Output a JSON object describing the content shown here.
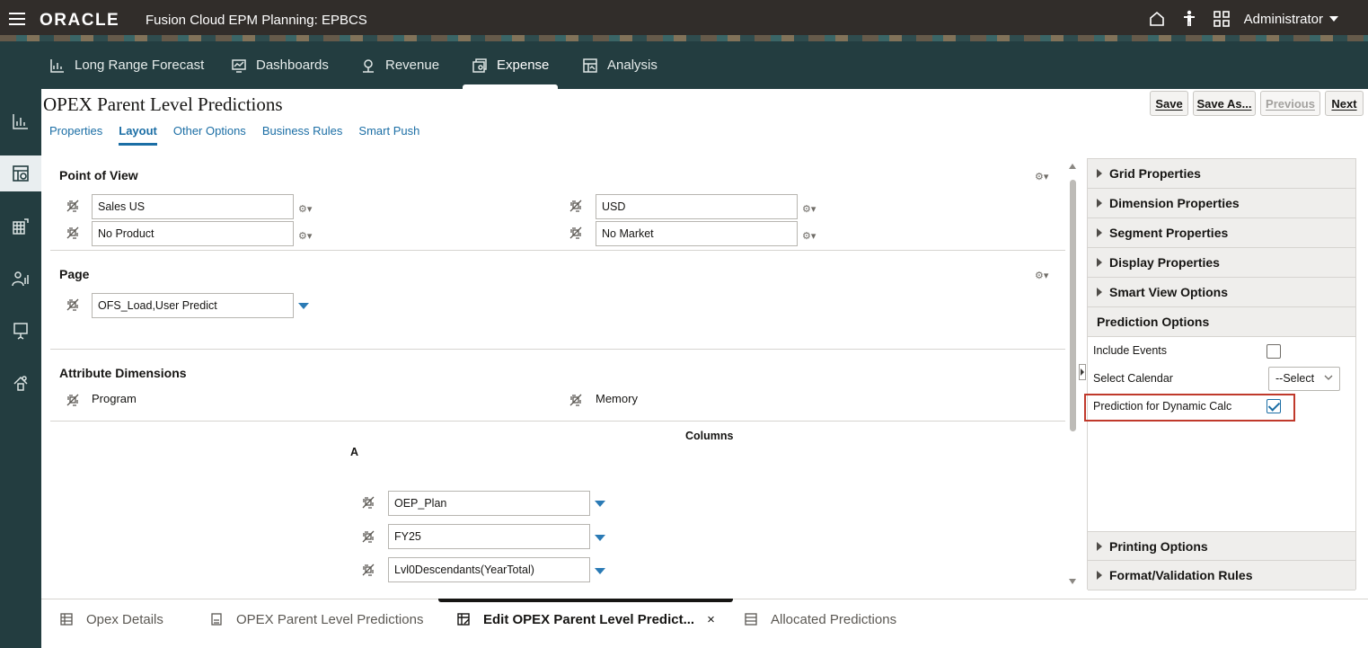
{
  "header": {
    "logo": "ORACLE",
    "app_title": "Fusion Cloud EPM Planning:  EPBCS",
    "user": "Administrator"
  },
  "nav": {
    "items": [
      {
        "label": "Long Range Forecast",
        "icon": "chart-icon"
      },
      {
        "label": "Dashboards",
        "icon": "dashboard-icon"
      },
      {
        "label": "Revenue",
        "icon": "revenue-icon"
      },
      {
        "label": "Expense",
        "icon": "expense-icon",
        "active": true
      },
      {
        "label": "Analysis",
        "icon": "analysis-icon"
      }
    ]
  },
  "page": {
    "title": "OPEX Parent Level Predictions",
    "buttons": {
      "save": "Save",
      "save_as": "Save As...",
      "previous": "Previous",
      "next": "Next"
    },
    "subtabs": [
      "Properties",
      "Layout",
      "Other Options",
      "Business Rules",
      "Smart Push"
    ],
    "active_subtab": "Layout"
  },
  "layout": {
    "pov_title": "Point of View",
    "pov": [
      "Sales US",
      "USD",
      "No Product",
      "No Market"
    ],
    "page_title": "Page",
    "page_member": "OFS_Load,User Predict",
    "attr_title": "Attribute Dimensions",
    "attributes": [
      "Program",
      "Memory"
    ],
    "columns_title": "Columns",
    "column_label": "A",
    "columns": [
      "OEP_Plan",
      "FY25",
      "Lvl0Descendants(YearTotal)"
    ]
  },
  "properties": {
    "sections_top": [
      "Grid Properties",
      "Dimension Properties",
      "Segment Properties",
      "Display Properties",
      "Smart View Options"
    ],
    "open_section": "Prediction Options",
    "include_events": "Include Events",
    "include_events_checked": false,
    "select_calendar": "Select Calendar",
    "select_value": "--Select",
    "prediction_dynamic": "Prediction for Dynamic Calc",
    "prediction_dynamic_checked": true,
    "sections_bottom": [
      "Printing Options",
      "Format/Validation Rules"
    ]
  },
  "bottom_tabs": [
    {
      "label": "Opex Details"
    },
    {
      "label": "OPEX Parent Level Predictions"
    },
    {
      "label": "Edit OPEX Parent Level Predict...",
      "active": true,
      "close": "×"
    },
    {
      "label": "Allocated Predictions"
    }
  ],
  "colors": {
    "accent": "#1b6ea5",
    "topbar": "#312d2a",
    "navbar": "#233d40",
    "highlight": "#c0392b"
  }
}
